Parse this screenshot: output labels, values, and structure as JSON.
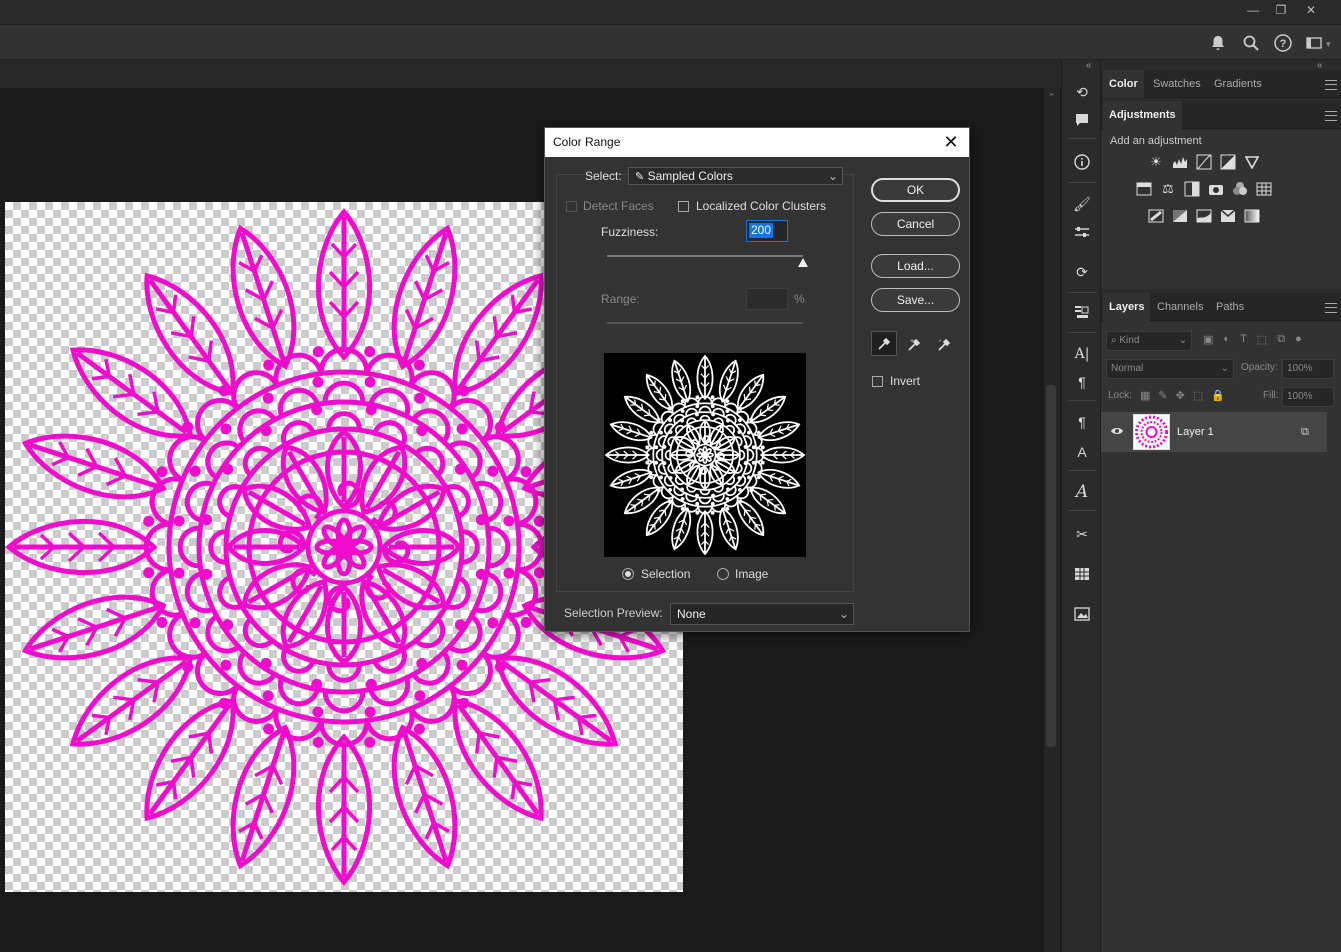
{
  "window_controls": {
    "minimize": "—",
    "restore": "❐",
    "close": "✕"
  },
  "options_bar": {
    "icons": [
      "bell-icon",
      "search-icon",
      "help-icon",
      "workspace-icon"
    ]
  },
  "color_panel": {
    "tabs": [
      "Color",
      "Swatches",
      "Gradients"
    ]
  },
  "adjustments_panel": {
    "tab": "Adjustments",
    "heading": "Add an adjustment"
  },
  "layers_panel": {
    "tabs": [
      "Layers",
      "Channels",
      "Paths"
    ],
    "filter_placeholder": "Kind",
    "blend_mode": "Normal",
    "opacity_label": "Opacity:",
    "opacity_value": "100%",
    "lock_label": "Lock:",
    "fill_label": "Fill:",
    "fill_value": "100%",
    "layers": [
      {
        "name": "Layer 1",
        "visible": true
      }
    ]
  },
  "color_range_dialog": {
    "title": "Color Range",
    "select_label": "Select:",
    "select_value": "Sampled Colors",
    "detect_faces_label": "Detect Faces",
    "detect_faces_checked": false,
    "localized_label": "Localized Color Clusters",
    "localized_checked": false,
    "fuzziness_label": "Fuzziness:",
    "fuzziness_value": "200",
    "fuzziness_max": 200,
    "range_label": "Range:",
    "range_value": "",
    "range_unit": "%",
    "preview_mode_selection": "Selection",
    "preview_mode_image": "Image",
    "preview_mode_selected": "Selection",
    "selection_preview_label": "Selection Preview:",
    "selection_preview_value": "None",
    "buttons": {
      "ok": "OK",
      "cancel": "Cancel",
      "load": "Load...",
      "save": "Save..."
    },
    "invert_label": "Invert",
    "invert_checked": false
  },
  "colors": {
    "artwork": "#f00ccc",
    "dialog_bg": "#333333",
    "panel_bg": "#2b2b2b",
    "highlight": "#1473e6"
  }
}
